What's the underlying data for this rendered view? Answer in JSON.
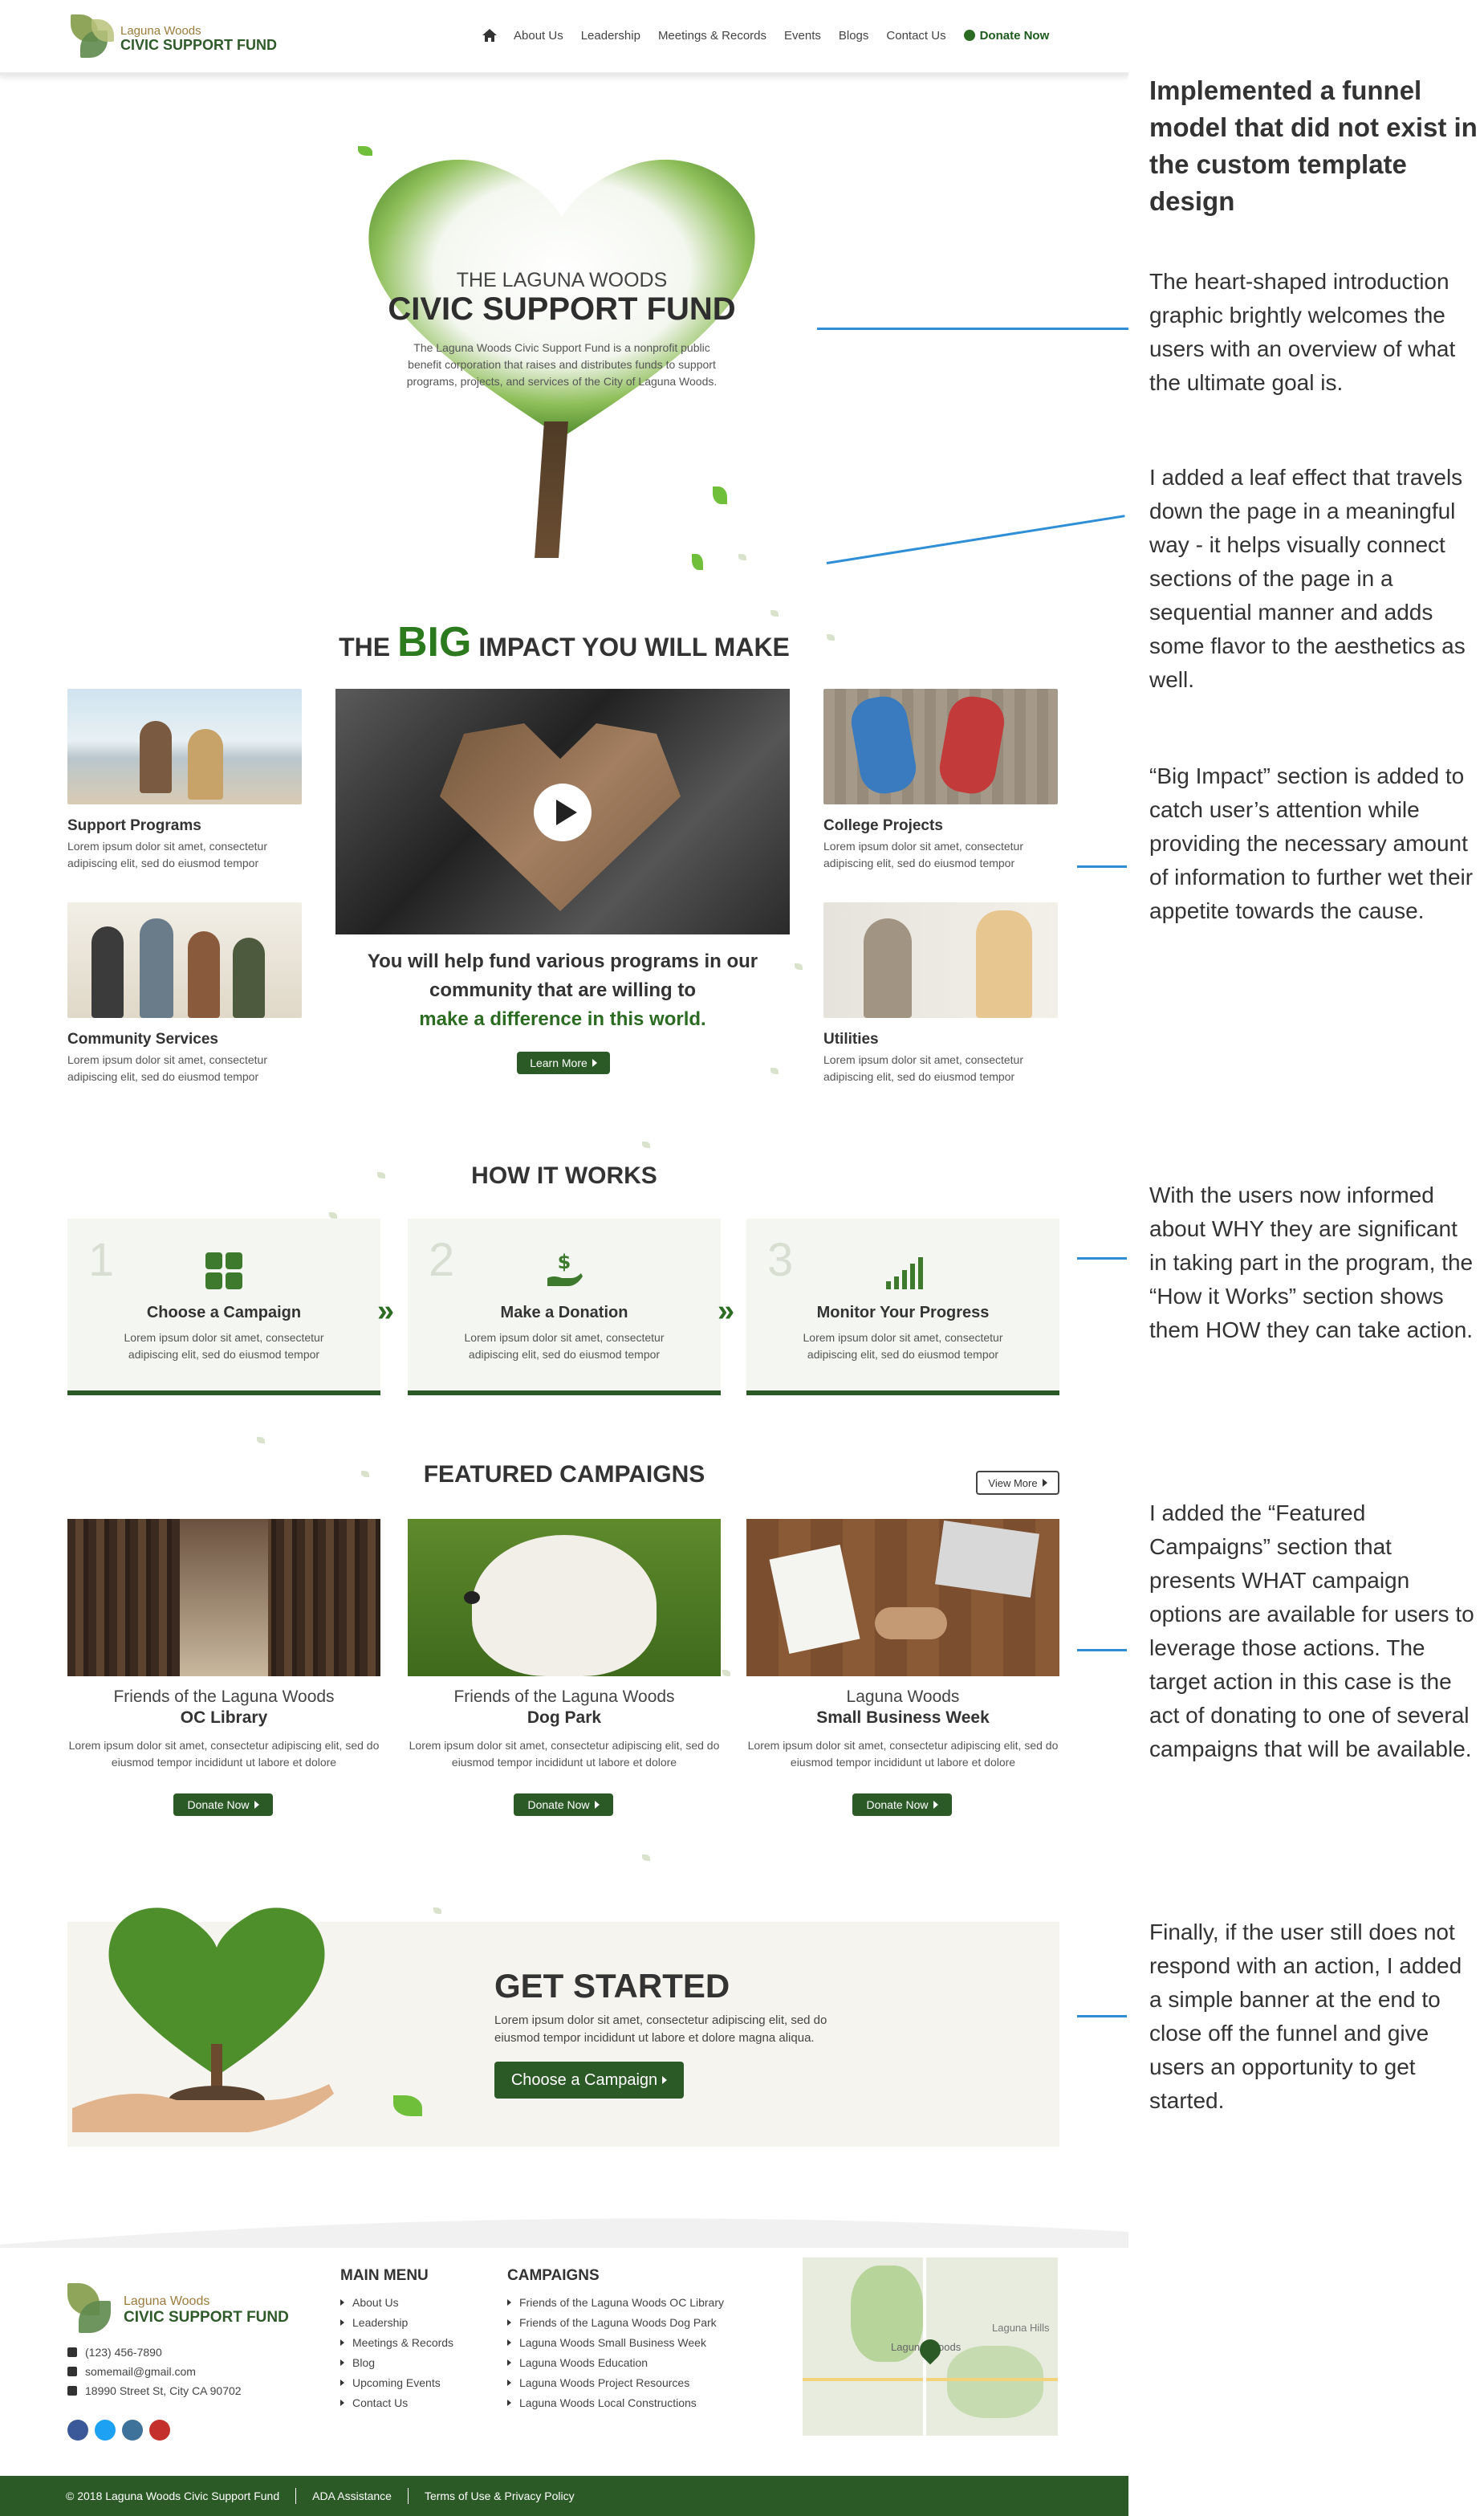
{
  "nav": {
    "logo_line1": "Laguna Woods",
    "logo_line2": "CIVIC SUPPORT FUND",
    "items": [
      "About Us",
      "Leadership",
      "Meetings & Records",
      "Events",
      "Blogs",
      "Contact Us"
    ],
    "donate": "Donate Now"
  },
  "hero": {
    "subtitle": "THE LAGUNA WOODS",
    "title": "CIVIC SUPPORT FUND",
    "description": "The Laguna Woods Civic Support Fund is a nonprofit public benefit corporation that raises and distributes funds to support programs, projects, and services of the City of Laguna Woods."
  },
  "impact": {
    "heading_pre": "THE",
    "heading_big": "BIG",
    "heading_post": "IMPACT YOU WILL MAKE",
    "cards": [
      {
        "title": "Support Programs",
        "desc": "Lorem ipsum dolor sit amet, consectetur adipiscing elit, sed do eiusmod tempor"
      },
      {
        "title": "Community Services",
        "desc": "Lorem ipsum dolor sit amet, consectetur adipiscing elit, sed do eiusmod tempor"
      },
      {
        "title": "College Projects",
        "desc": "Lorem ipsum dolor sit amet, consectetur adipiscing elit, sed do eiusmod tempor"
      },
      {
        "title": "Utilities",
        "desc": "Lorem ipsum dolor sit amet, consectetur adipiscing elit, sed do eiusmod tempor"
      }
    ],
    "text_line1": "You will help fund various programs in our community that are willing to",
    "text_green": "make a difference in this world.",
    "learn_more": "Learn More"
  },
  "how": {
    "heading": "HOW IT WORKS",
    "steps": [
      {
        "num": "1",
        "title": "Choose a Campaign",
        "desc": "Lorem ipsum dolor sit amet, consectetur adipiscing elit, sed do eiusmod tempor"
      },
      {
        "num": "2",
        "title": "Make a Donation",
        "desc": "Lorem ipsum dolor sit amet, consectetur adipiscing elit, sed do eiusmod tempor"
      },
      {
        "num": "3",
        "title": "Monitor Your Progress",
        "desc": "Lorem ipsum dolor sit amet, consectetur adipiscing elit, sed do eiusmod tempor"
      }
    ],
    "chevron": "»"
  },
  "featured": {
    "heading": "FEATURED CAMPAIGNS",
    "view_more": "View More",
    "campaigns": [
      {
        "org": "Friends of the Laguna Woods",
        "title": "OC Library",
        "desc": "Lorem ipsum dolor sit amet, consectetur adipiscing elit, sed do eiusmod tempor incididunt ut labore et dolore",
        "button": "Donate Now"
      },
      {
        "org": "Friends of the Laguna Woods",
        "title": "Dog Park",
        "desc": "Lorem ipsum dolor sit amet, consectetur adipiscing elit, sed do eiusmod tempor incididunt ut labore et dolore",
        "button": "Donate Now"
      },
      {
        "org": "Laguna Woods",
        "title": "Small Business Week",
        "desc": "Lorem ipsum dolor sit amet, consectetur adipiscing elit, sed do eiusmod tempor incididunt ut labore et dolore",
        "button": "Donate Now"
      }
    ]
  },
  "get_started": {
    "title": "GET STARTED",
    "desc": "Lorem ipsum dolor sit amet, consectetur adipiscing elit, sed do eiusmod tempor incididunt ut labore et dolore magna aliqua.",
    "button": "Choose a Campaign"
  },
  "footer": {
    "logo_line1": "Laguna Woods",
    "logo_line2": "CIVIC SUPPORT FUND",
    "phone": "(123) 456-7890",
    "email": "somemail@gmail.com",
    "address": "18990 Street St, City CA 90702",
    "main_menu_heading": "MAIN MENU",
    "main_menu": [
      "About Us",
      "Leadership",
      "Meetings & Records",
      "Blog",
      "Upcoming Events",
      "Contact Us"
    ],
    "campaigns_heading": "CAMPAIGNS",
    "campaigns": [
      "Friends of the Laguna Woods  OC Library",
      "Friends of the Laguna Woods Dog Park",
      "Laguna Woods Small Business Week",
      "Laguna Woods Education",
      "Laguna Woods Project Resources",
      "Laguna Woods Local Constructions"
    ],
    "map_label": "Laguna Woods",
    "map_label2": "Laguna Hills",
    "copyright": "© 2018 Laguna Woods Civic Support Fund",
    "ada": "ADA Assistance",
    "terms": "Terms of Use & Privacy Policy",
    "social_colors": [
      "#3b5998",
      "#1da1f2",
      "#3f729b",
      "#c4302b"
    ]
  },
  "annotations": [
    "Implemented a funnel model that did not exist in the custom template design",
    "The heart-shaped introduction graphic brightly welcomes the users with an overview of what the ultimate goal is.",
    "I added a leaf effect that travels down the page in a meaningful way - it helps visually connect sections of the page in a sequential manner and adds some flavor to the aesthetics as well.",
    "“Big Impact” section is added to catch user’s attention while providing the necessary amount of information to further wet their appetite towards the cause.",
    "With the users now informed about WHY they are significant in taking part in the program, the “How it Works” section shows them HOW they can take action.",
    "I added the “Featured Campaigns” section that presents WHAT campaign options are available for users to leverage those actions. The target action in this case is the act of donating to one of several campaigns that will be available.",
    "Finally, if the user still does not respond with an action, I added a simple banner at the end to close off the funnel and give users an opportunity to get started."
  ]
}
